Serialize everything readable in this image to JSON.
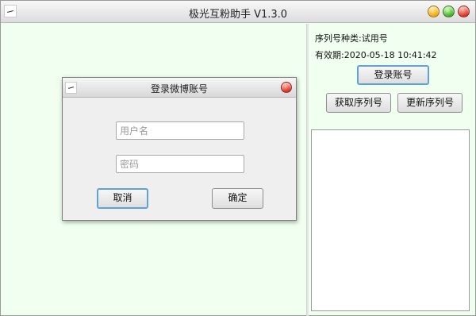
{
  "window": {
    "title": "极光互粉助手 V1.3.0",
    "controls": [
      "minimize",
      "maximize",
      "close"
    ]
  },
  "info": {
    "serial_type_label": "序列号种类:",
    "serial_type_value": "试用号",
    "expiry_label": "有效期:",
    "expiry_value": "2020-05-18 10:41:42"
  },
  "buttons": {
    "login_account": "登录账号",
    "get_serial": "获取序列号",
    "update_serial": "更新序列号"
  },
  "dialog": {
    "title": "登录微博账号",
    "username_placeholder": "用户名",
    "password_placeholder": "密码",
    "cancel": "取消",
    "confirm": "确定"
  },
  "colors": {
    "pane_background": "#f0fff0",
    "focus_border": "#5ea2d8"
  }
}
